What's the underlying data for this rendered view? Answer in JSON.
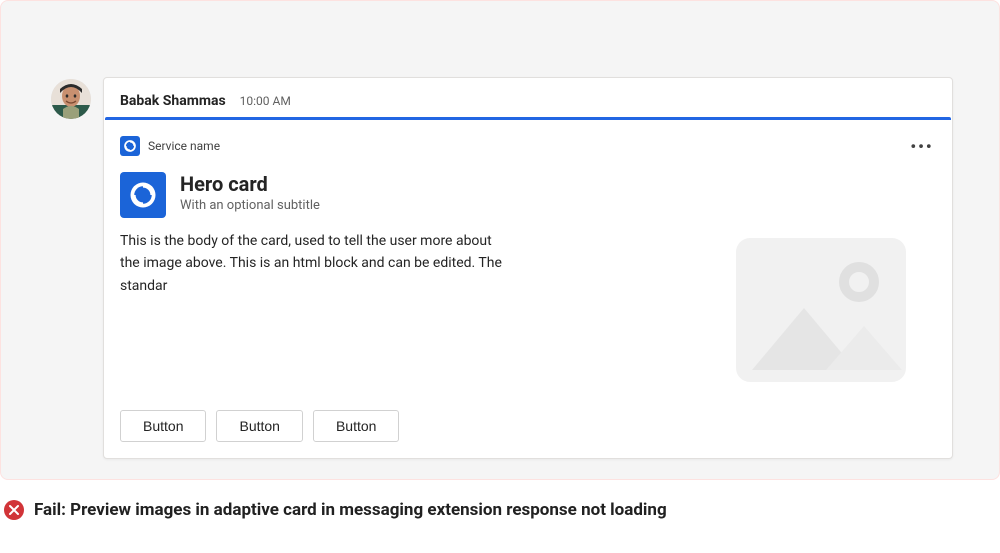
{
  "sender": {
    "name": "Babak Shammas",
    "timestamp": "10:00 AM"
  },
  "service": {
    "name": "Service name"
  },
  "hero": {
    "title": "Hero card",
    "subtitle": "With an optional subtitle"
  },
  "body_text": "This is the body of the card, used to tell the user more about the image above. This is an html block and can be edited. The standar",
  "actions": [
    {
      "label": "Button"
    },
    {
      "label": "Button"
    },
    {
      "label": "Button"
    }
  ],
  "fail_message": "Fail: Preview images in adaptive card in messaging extension response not loading"
}
